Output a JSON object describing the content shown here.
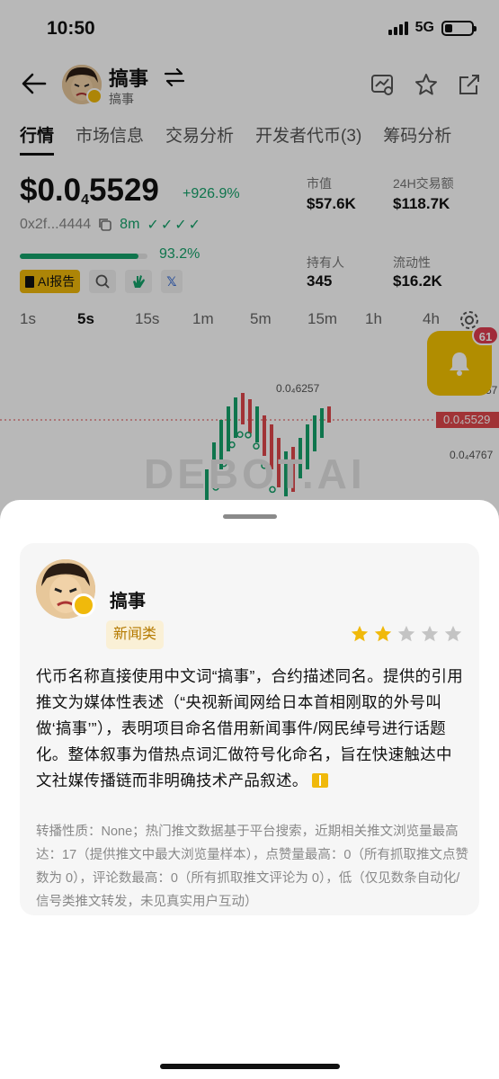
{
  "status_bar": {
    "time": "10:50",
    "network": "5G",
    "battery_level": 0.3
  },
  "header": {
    "token_name": "搞事",
    "token_subtitle": "搞事",
    "icons": [
      "back-arrow-icon",
      "swap-icon",
      "scan-icon",
      "star-icon",
      "share-icon"
    ]
  },
  "tabs": [
    {
      "label": "行情",
      "active": true
    },
    {
      "label": "市场信息",
      "active": false
    },
    {
      "label": "交易分析",
      "active": false
    },
    {
      "label": "开发者代币(3)",
      "active": false
    },
    {
      "label": "筹码分析",
      "active": false
    }
  ],
  "market": {
    "price_prefix": "$0.0",
    "price_sub": "4",
    "price_tail": "5529",
    "change": "+926.9%",
    "address": "0x2f...4444",
    "age": "8m",
    "checks": "✓✓✓✓",
    "progress_text": "93.2%",
    "progress_value": 0.932,
    "ai_chip": "AI报告"
  },
  "stats": {
    "market_cap_label": "市值",
    "market_cap": "$57.6K",
    "volume_label": "24H交易额",
    "volume": "$118.7K",
    "holders_label": "持有人",
    "holders": "345",
    "liquidity_label": "流动性",
    "liquidity": "$16.2K"
  },
  "intervals": [
    {
      "label": "1s",
      "active": false
    },
    {
      "label": "5s",
      "active": true
    },
    {
      "label": "15s",
      "active": false
    },
    {
      "label": "1m",
      "active": false
    },
    {
      "label": "5m",
      "active": false
    },
    {
      "label": "15m",
      "active": false
    },
    {
      "label": "1h",
      "active": false
    },
    {
      "label": "4h",
      "active": false
    }
  ],
  "chart": {
    "high_label": "0.0₄6257",
    "current_label": "0.0₄5529",
    "low_label": "0.0₄4767",
    "right_cut_label": "57",
    "watermark": "DEBOT.AI"
  },
  "notification": {
    "count": "61"
  },
  "sheet": {
    "name": "搞事",
    "tag": "新闻类",
    "rating": 2,
    "rating_max": 5,
    "description": "代币名称直接使用中文词“搞事”，合约描述同名。提供的引用推文为媒体性表述（“央视新闻网给日本首相刚取的外号叫做‘搞事’”），表明项目命名借用新闻事件/网民绰号进行话题化。整体叙事为借热点词汇做符号化命名，旨在快速触达中文社媒传播链而非明确技术产品叙述。",
    "meta": "转播性质：None；热门推文数据基于平台搜索，近期相关推文浏览量最高达：17（提供推文中最大浏览量样本），点赞量最高：0（所有抓取推文点赞数为 0），评论数最高：0（所有抓取推文评论为 0），低（仅见数条自动化/信号类推文转发，未见真实用户互动）"
  },
  "colors": {
    "accent": "#f0b90b",
    "up": "#15a36b",
    "down": "#e0474b"
  }
}
